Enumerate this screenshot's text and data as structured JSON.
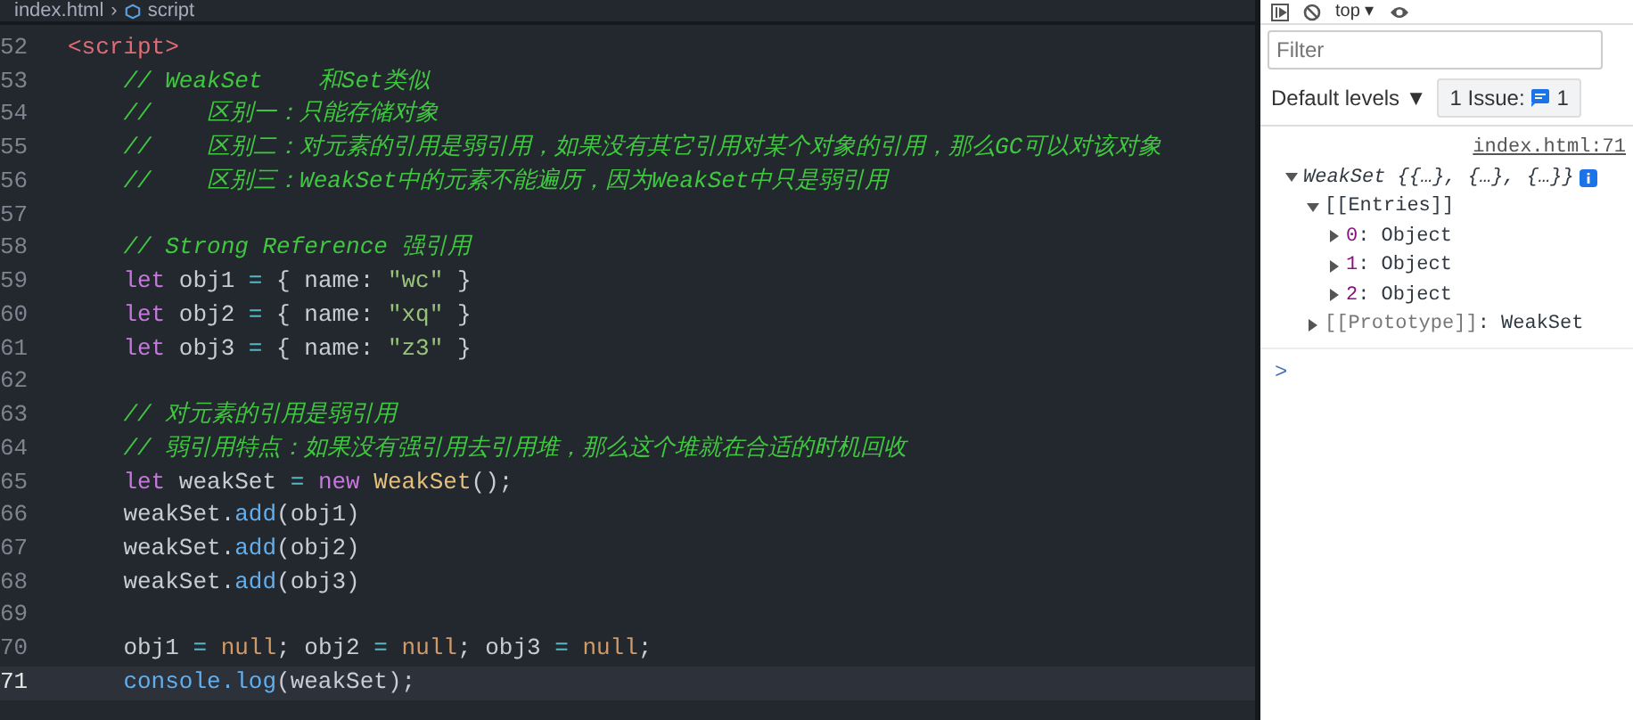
{
  "breadcrumb": {
    "separator": "›",
    "items": [
      "index.html",
      "script"
    ]
  },
  "editor": {
    "lines": [
      {
        "number": "52",
        "current": false,
        "tokens": [
          {
            "kind": "tag",
            "text": "<script>"
          }
        ]
      },
      {
        "number": "53",
        "current": false,
        "tokens": [
          {
            "kind": "comment",
            "text": "    // WeakSet    和Set类似"
          }
        ]
      },
      {
        "number": "54",
        "current": false,
        "tokens": [
          {
            "kind": "comment",
            "text": "    //    区别一：只能存储对象"
          }
        ]
      },
      {
        "number": "55",
        "current": false,
        "tokens": [
          {
            "kind": "comment",
            "text": "    //    区别二：对元素的引用是弱引用，如果没有其它引用对某个对象的引用，那么GC可以对该对象"
          }
        ]
      },
      {
        "number": "56",
        "current": false,
        "tokens": [
          {
            "kind": "comment",
            "text": "    //    区别三：WeakSet中的元素不能遍历，因为WeakSet中只是弱引用"
          }
        ]
      },
      {
        "number": "57",
        "current": false
      },
      {
        "number": "58",
        "current": false,
        "tokens": [
          {
            "kind": "comment",
            "text": "    // Strong Reference 强引用"
          }
        ]
      },
      {
        "number": "59",
        "current": false,
        "tokens": [
          {
            "kind": "keyword",
            "text": "    let"
          },
          {
            "kind": "plain",
            "text": " obj1 "
          },
          {
            "kind": "op",
            "text": "="
          },
          {
            "kind": "plain",
            "text": " { name: "
          },
          {
            "kind": "string",
            "text": "\"wc\""
          },
          {
            "kind": "plain",
            "text": " }"
          }
        ]
      },
      {
        "number": "60",
        "current": false,
        "tokens": [
          {
            "kind": "keyword",
            "text": "    let"
          },
          {
            "kind": "plain",
            "text": " obj2 "
          },
          {
            "kind": "op",
            "text": "="
          },
          {
            "kind": "plain",
            "text": " { name: "
          },
          {
            "kind": "string",
            "text": "\"xq\""
          },
          {
            "kind": "plain",
            "text": " }"
          }
        ]
      },
      {
        "number": "61",
        "current": false,
        "tokens": [
          {
            "kind": "keyword",
            "text": "    let"
          },
          {
            "kind": "plain",
            "text": " obj3 "
          },
          {
            "kind": "op",
            "text": "="
          },
          {
            "kind": "plain",
            "text": " { name: "
          },
          {
            "kind": "string",
            "text": "\"z3\""
          },
          {
            "kind": "plain",
            "text": " }"
          }
        ]
      },
      {
        "number": "62",
        "current": false
      },
      {
        "number": "63",
        "current": false,
        "tokens": [
          {
            "kind": "comment",
            "text": "    // 对元素的引用是弱引用"
          }
        ]
      },
      {
        "number": "64",
        "current": false,
        "tokens": [
          {
            "kind": "comment",
            "text": "    // 弱引用特点：如果没有强引用去引用堆，那么这个堆就在合适的时机回收"
          }
        ]
      },
      {
        "number": "65",
        "current": false,
        "tokens": [
          {
            "kind": "keyword",
            "text": "    let"
          },
          {
            "kind": "plain",
            "text": " weakSet "
          },
          {
            "kind": "op",
            "text": "="
          },
          {
            "kind": "keyword",
            "text": " new"
          },
          {
            "kind": "class",
            "text": " WeakSet"
          },
          {
            "kind": "plain",
            "text": "();"
          }
        ]
      },
      {
        "number": "66",
        "current": false,
        "tokens": [
          {
            "kind": "plain",
            "text": "    weakSet."
          },
          {
            "kind": "func",
            "text": "add"
          },
          {
            "kind": "plain",
            "text": "(obj1)"
          }
        ]
      },
      {
        "number": "67",
        "current": false,
        "tokens": [
          {
            "kind": "plain",
            "text": "    weakSet."
          },
          {
            "kind": "func",
            "text": "add"
          },
          {
            "kind": "plain",
            "text": "(obj2)"
          }
        ]
      },
      {
        "number": "68",
        "current": false,
        "tokens": [
          {
            "kind": "plain",
            "text": "    weakSet."
          },
          {
            "kind": "func",
            "text": "add"
          },
          {
            "kind": "plain",
            "text": "(obj3)"
          }
        ]
      },
      {
        "number": "69",
        "current": false
      },
      {
        "number": "70",
        "current": false,
        "tokens": [
          {
            "kind": "plain",
            "text": "    obj1 "
          },
          {
            "kind": "op",
            "text": "="
          },
          {
            "kind": "null",
            "text": " null"
          },
          {
            "kind": "plain",
            "text": "; obj2 "
          },
          {
            "kind": "op",
            "text": "="
          },
          {
            "kind": "null",
            "text": " null"
          },
          {
            "kind": "plain",
            "text": "; obj3 "
          },
          {
            "kind": "op",
            "text": "="
          },
          {
            "kind": "null",
            "text": " null"
          },
          {
            "kind": "plain",
            "text": ";"
          }
        ]
      },
      {
        "number": "71",
        "current": true,
        "tokens": [
          {
            "kind": "func",
            "text": "    console.log"
          },
          {
            "kind": "plain",
            "text": "(weakSet);"
          }
        ]
      }
    ]
  },
  "devtools": {
    "context": "top ▾",
    "filter": {
      "placeholder": "Filter"
    },
    "levels": "Default levels ▼",
    "issues": {
      "label": "1 Issue:",
      "count": "1"
    },
    "source_link": "index.html:71",
    "tree": [
      {
        "key": "WeakSet {{…}, {…}, {…}}",
        "expanded": true,
        "children": [
          {
            "key": "[[Entries]]",
            "expanded": true,
            "children": [
              {
                "key": "0",
                "value": ": Object",
                "expanded": false
              },
              {
                "key": "1",
                "value": ": Object",
                "expanded": false
              },
              {
                "key": "2",
                "value": ": Object",
                "expanded": false
              }
            ]
          },
          {
            "key": "[[Prototype]]",
            "value": ": WeakSet",
            "expanded": false
          }
        ]
      }
    ],
    "prompt": ">"
  }
}
